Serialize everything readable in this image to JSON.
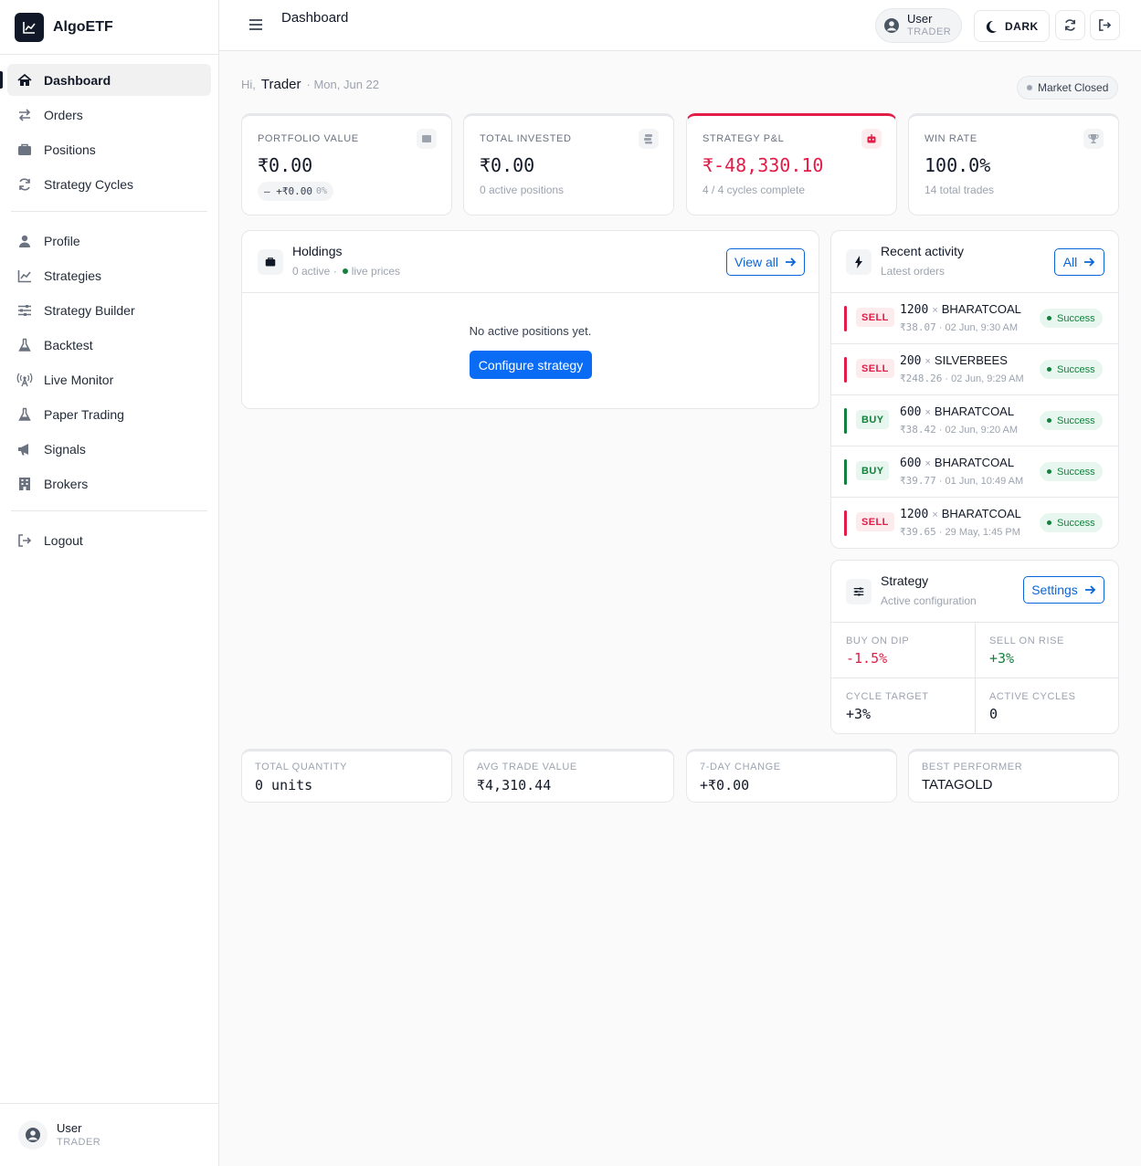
{
  "app": {
    "name": "AlgoETF"
  },
  "sidebar": {
    "items": [
      {
        "label": "Dashboard",
        "icon": "home-icon",
        "active": true
      },
      {
        "label": "Orders",
        "icon": "swap-icon"
      },
      {
        "label": "Positions",
        "icon": "briefcase-icon"
      },
      {
        "label": "Strategy Cycles",
        "icon": "sync-icon"
      },
      {
        "label": "Profile",
        "icon": "user-icon"
      },
      {
        "label": "Strategies",
        "icon": "chart-line-icon"
      },
      {
        "label": "Strategy Builder",
        "icon": "sliders-icon"
      },
      {
        "label": "Backtest",
        "icon": "flask-icon"
      },
      {
        "label": "Live Monitor",
        "icon": "broadcast-icon"
      },
      {
        "label": "Paper Trading",
        "icon": "flask-icon"
      },
      {
        "label": "Signals",
        "icon": "megaphone-icon"
      },
      {
        "label": "Brokers",
        "icon": "building-icon"
      },
      {
        "label": "Logout",
        "icon": "sign-out-icon"
      }
    ],
    "user": {
      "name": "User",
      "role": "TRADER"
    }
  },
  "topbar": {
    "title": "Dashboard",
    "user": {
      "name": "User",
      "role": "TRADER"
    },
    "theme_label": "DARK"
  },
  "greeting": {
    "prefix": "Hi,",
    "name": "Trader",
    "date": "· Mon, Jun 22"
  },
  "market_status": "Market Closed",
  "kpis": {
    "portfolio": {
      "label": "PORTFOLIO VALUE",
      "value": "₹0.00",
      "change": "— +₹0.00",
      "change_pct": "0%"
    },
    "invested": {
      "label": "TOTAL INVESTED",
      "value": "₹0.00",
      "sub": "0 active positions"
    },
    "pnl": {
      "label": "STRATEGY P&L",
      "value": "₹-48,330.10",
      "sub": "4 / 4 cycles complete",
      "color": "#e11d48"
    },
    "winrate": {
      "label": "WIN RATE",
      "value": "100.0%",
      "sub": "14 total trades"
    }
  },
  "holdings": {
    "title": "Holdings",
    "active": "0 active ·",
    "live": "live prices",
    "view_all": "View all",
    "empty": "No active positions yet.",
    "cta": "Configure strategy"
  },
  "activity": {
    "title": "Recent activity",
    "subtitle": "Latest orders",
    "all_label": "All",
    "orders": [
      {
        "side": "SELL",
        "qty": "1200",
        "symbol": "BHARATCOAL",
        "price": "₹38.07",
        "time": "· 02 Jun, 9:30 AM",
        "status": "Success"
      },
      {
        "side": "SELL",
        "qty": "200",
        "symbol": "SILVERBEES",
        "price": "₹248.26",
        "time": "· 02 Jun, 9:29 AM",
        "status": "Success"
      },
      {
        "side": "BUY",
        "qty": "600",
        "symbol": "BHARATCOAL",
        "price": "₹38.42",
        "time": "· 02 Jun, 9:20 AM",
        "status": "Success"
      },
      {
        "side": "BUY",
        "qty": "600",
        "symbol": "BHARATCOAL",
        "price": "₹39.77",
        "time": "· 01 Jun, 10:49 AM",
        "status": "Success"
      },
      {
        "side": "SELL",
        "qty": "1200",
        "symbol": "BHARATCOAL",
        "price": "₹39.65",
        "time": "· 29 May, 1:45 PM",
        "status": "Success"
      }
    ]
  },
  "strategy": {
    "title": "Strategy",
    "subtitle": "Active configuration",
    "settings_label": "Settings",
    "buy_on_dip": {
      "label": "BUY ON DIP",
      "value": "-1.5%"
    },
    "sell_on_rise": {
      "label": "SELL ON RISE",
      "value": "+3%"
    },
    "cycle_target": {
      "label": "CYCLE TARGET",
      "value": "+3%"
    },
    "active_cycles": {
      "label": "ACTIVE CYCLES",
      "value": "0"
    }
  },
  "footer_stats": {
    "total_qty": {
      "label": "TOTAL QUANTITY",
      "value": "0 units"
    },
    "avg_trade": {
      "label": "AVG TRADE VALUE",
      "value": "₹4,310.44"
    },
    "change7d": {
      "label": "7-DAY CHANGE",
      "value": "+₹0.00"
    },
    "best": {
      "label": "BEST PERFORMER",
      "value": "TATAGOLD"
    }
  },
  "colors": {
    "accent": "#0a66d8",
    "sell": "#e11d48",
    "buy": "#15803d"
  }
}
